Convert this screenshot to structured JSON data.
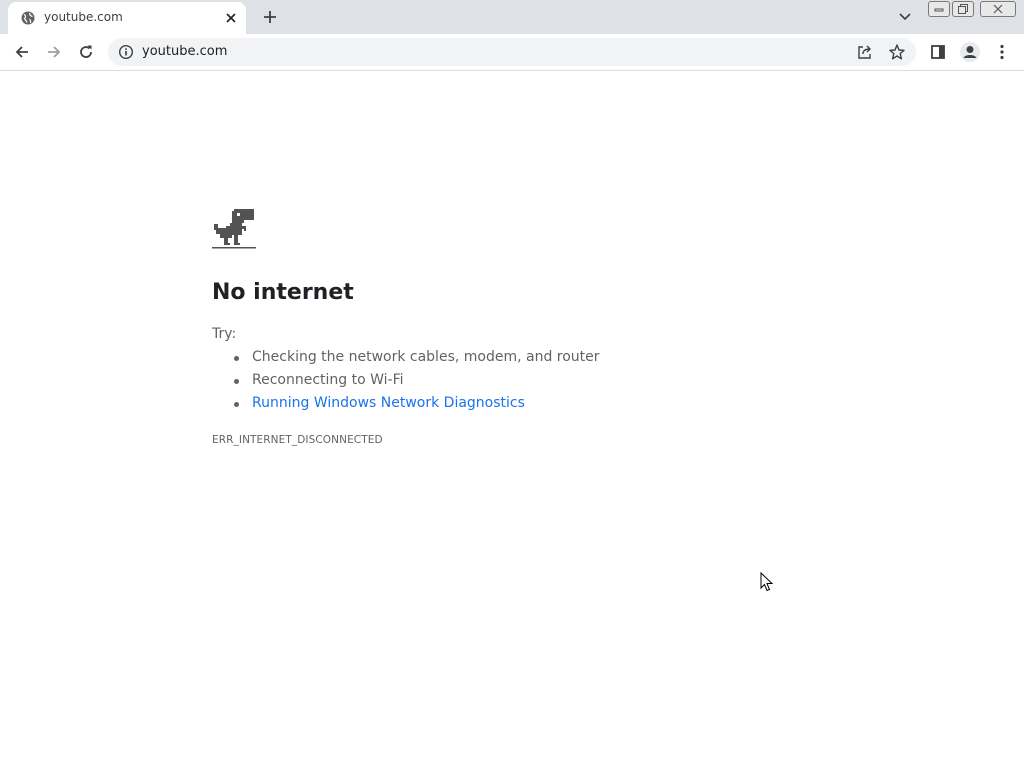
{
  "tabs": [
    {
      "title": "youtube.com",
      "favicon": "globe-icon",
      "active": true
    }
  ],
  "toolbar": {
    "url": "youtube.com",
    "icons": [
      "back-icon",
      "forward-icon",
      "reload-icon",
      "info-icon",
      "share-icon",
      "star-icon",
      "side-panel-icon",
      "profile-icon",
      "menu-icon"
    ]
  },
  "error_page": {
    "icon": "offline-dino-icon",
    "title": "No internet",
    "try_label": "Try:",
    "suggestions": [
      "Checking the network cables, modem, and router",
      "Reconnecting to Wi-Fi",
      "Running Windows Network Diagnostics"
    ],
    "error_code": "ERR_INTERNET_DISCONNECTED"
  },
  "colors": {
    "tabstrip": "#dee1e6",
    "link": "#1a73e8",
    "text": "#202124",
    "secondary_text": "#5f6368"
  }
}
